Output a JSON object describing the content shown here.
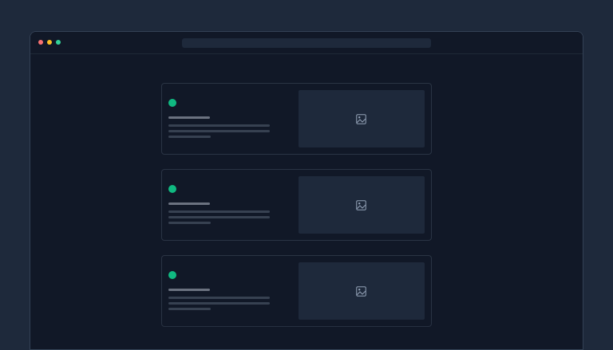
{
  "colors": {
    "page_background": "#1e293b",
    "window_background": "#111827",
    "close_dot": "#f87171",
    "minimize_dot": "#fbbf24",
    "maximize_dot": "#34d399",
    "status_dot": "#10b981"
  },
  "window": {
    "address_bar_value": ""
  },
  "feed": {
    "cards": [
      {
        "status": "active",
        "thumbnail_icon": "image-icon"
      },
      {
        "status": "active",
        "thumbnail_icon": "image-icon"
      },
      {
        "status": "active",
        "thumbnail_icon": "image-icon"
      }
    ]
  }
}
